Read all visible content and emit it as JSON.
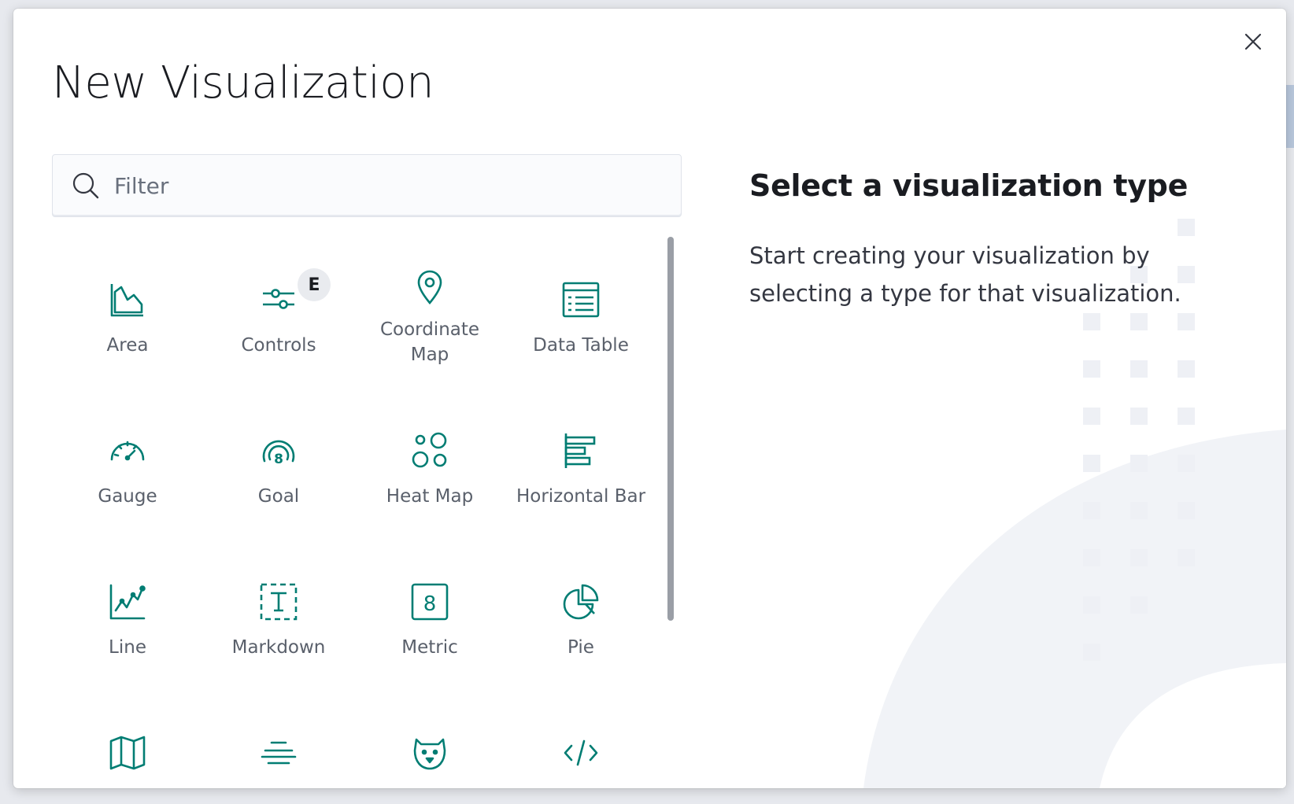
{
  "modal": {
    "title": "New Visualization",
    "close_icon": "close-icon"
  },
  "filter": {
    "placeholder": "Filter",
    "value": "",
    "icon": "search-icon"
  },
  "types": [
    {
      "label": "Area",
      "icon": "area-chart-icon"
    },
    {
      "label": "Controls",
      "icon": "controls-icon",
      "badge": "E"
    },
    {
      "label": "Coordinate Map",
      "icon": "map-marker-icon"
    },
    {
      "label": "Data Table",
      "icon": "table-icon"
    },
    {
      "label": "Gauge",
      "icon": "gauge-icon"
    },
    {
      "label": "Goal",
      "icon": "goal-icon"
    },
    {
      "label": "Heat Map",
      "icon": "heatmap-icon"
    },
    {
      "label": "Horizontal Bar",
      "icon": "horizontal-bar-icon"
    },
    {
      "label": "Line",
      "icon": "line-chart-icon"
    },
    {
      "label": "Markdown",
      "icon": "markdown-icon"
    },
    {
      "label": "Metric",
      "icon": "metric-icon"
    },
    {
      "label": "Pie",
      "icon": "pie-chart-icon"
    },
    {
      "label": "",
      "icon": "region-map-icon"
    },
    {
      "label": "",
      "icon": "tag-cloud-icon"
    },
    {
      "label": "",
      "icon": "timelion-icon"
    },
    {
      "label": "",
      "icon": "vega-code-icon"
    }
  ],
  "info": {
    "title": "Select a visualization type",
    "description": "Start creating your visualization by selecting a type for that visualization."
  },
  "colors": {
    "icon": "#017d73",
    "label": "#5a606b",
    "title": "#1a1c21"
  }
}
